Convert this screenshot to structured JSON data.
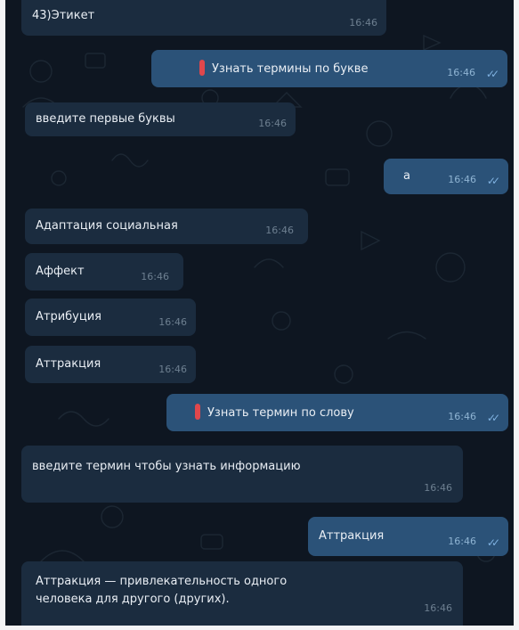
{
  "chat": {
    "messages": [
      {
        "dir": "in",
        "text": "43)Этикет",
        "time": "16:46"
      },
      {
        "dir": "out",
        "text": "Узнать термины по букве",
        "time": "16:46",
        "emoji": "pin-icon"
      },
      {
        "dir": "in",
        "text": "введите первые буквы",
        "time": "16:46"
      },
      {
        "dir": "out",
        "text": "а",
        "time": "16:46"
      },
      {
        "dir": "in",
        "text": "Адаптация социальная",
        "time": "16:46"
      },
      {
        "dir": "in",
        "text": "Аффект",
        "time": "16:46"
      },
      {
        "dir": "in",
        "text": "Атрибуция",
        "time": "16:46"
      },
      {
        "dir": "in",
        "text": "Аттракция",
        "time": "16:46"
      },
      {
        "dir": "out",
        "text": "Узнать термин по слову",
        "time": "16:46",
        "emoji": "pin-icon"
      },
      {
        "dir": "in",
        "text": "введите термин чтобы узнать информацию",
        "time": "16:46"
      },
      {
        "dir": "out",
        "text": "Аттракция",
        "time": "16:46"
      },
      {
        "dir": "in",
        "lines": [
          "Аттракция — привлекательность одного",
          "человека для другого (других)."
        ],
        "time": "16:46"
      }
    ],
    "read_mark": "✓✓",
    "colors": {
      "background": "#0e1621",
      "incoming": "#1b2c3f",
      "outgoing": "#2b5278",
      "emoji": "#e0474c"
    }
  }
}
